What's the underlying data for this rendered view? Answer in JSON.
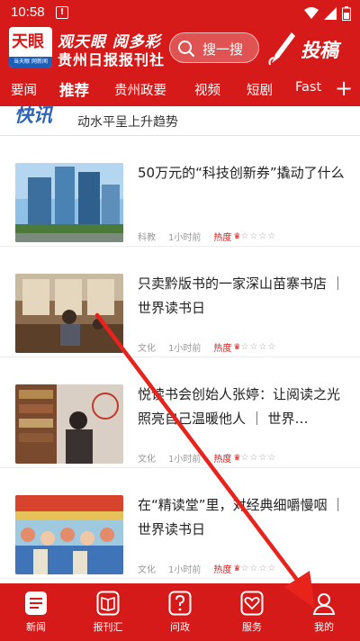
{
  "status_bar": {
    "time": "10:58"
  },
  "header": {
    "logo_text": "天眼",
    "logo_sub": "当天眼 网新闻",
    "brand_line1": "观天眼 阅多彩",
    "brand_line2": "贵州日报报刊社",
    "search_placeholder": "搜一搜",
    "contribute_label": "投稿"
  },
  "tabs": [
    "要闻",
    "推荐",
    "贵州政要",
    "视频",
    "短剧",
    "Fast"
  ],
  "active_tab": "推荐",
  "ticker": {
    "badge": "快讯",
    "text": "动水平呈上升趋势"
  },
  "articles": [
    {
      "title": "50万元的“科技创新券”撬动了什么",
      "category": "科教",
      "time": "1小时前",
      "heat_label": "热度"
    },
    {
      "title": "只卖黔版书的一家深山苗寨书店 ｜ 世界读书日",
      "category": "文化",
      "time": "1小时前",
      "heat_label": "热度"
    },
    {
      "title": "悦读书会创始人张婷：让阅读之光照亮自己温暖他人 ｜ 世界…",
      "category": "文化",
      "time": "1小时前",
      "heat_label": "热度"
    },
    {
      "title": "在“精读堂”里，对经典细嚼慢咽 ｜ 世界读书日",
      "category": "文化",
      "time": "1小时前",
      "heat_label": "热度"
    }
  ],
  "bottom_nav": [
    {
      "label": "新闻",
      "icon": "news-icon"
    },
    {
      "label": "报刊汇",
      "icon": "book-icon"
    },
    {
      "label": "问政",
      "icon": "question-icon"
    },
    {
      "label": "服务",
      "icon": "heart-hands-icon"
    },
    {
      "label": "我的",
      "icon": "user-icon"
    }
  ],
  "colors": {
    "brand_red": "#d61a1a",
    "accent_blue": "#2f64b5"
  }
}
